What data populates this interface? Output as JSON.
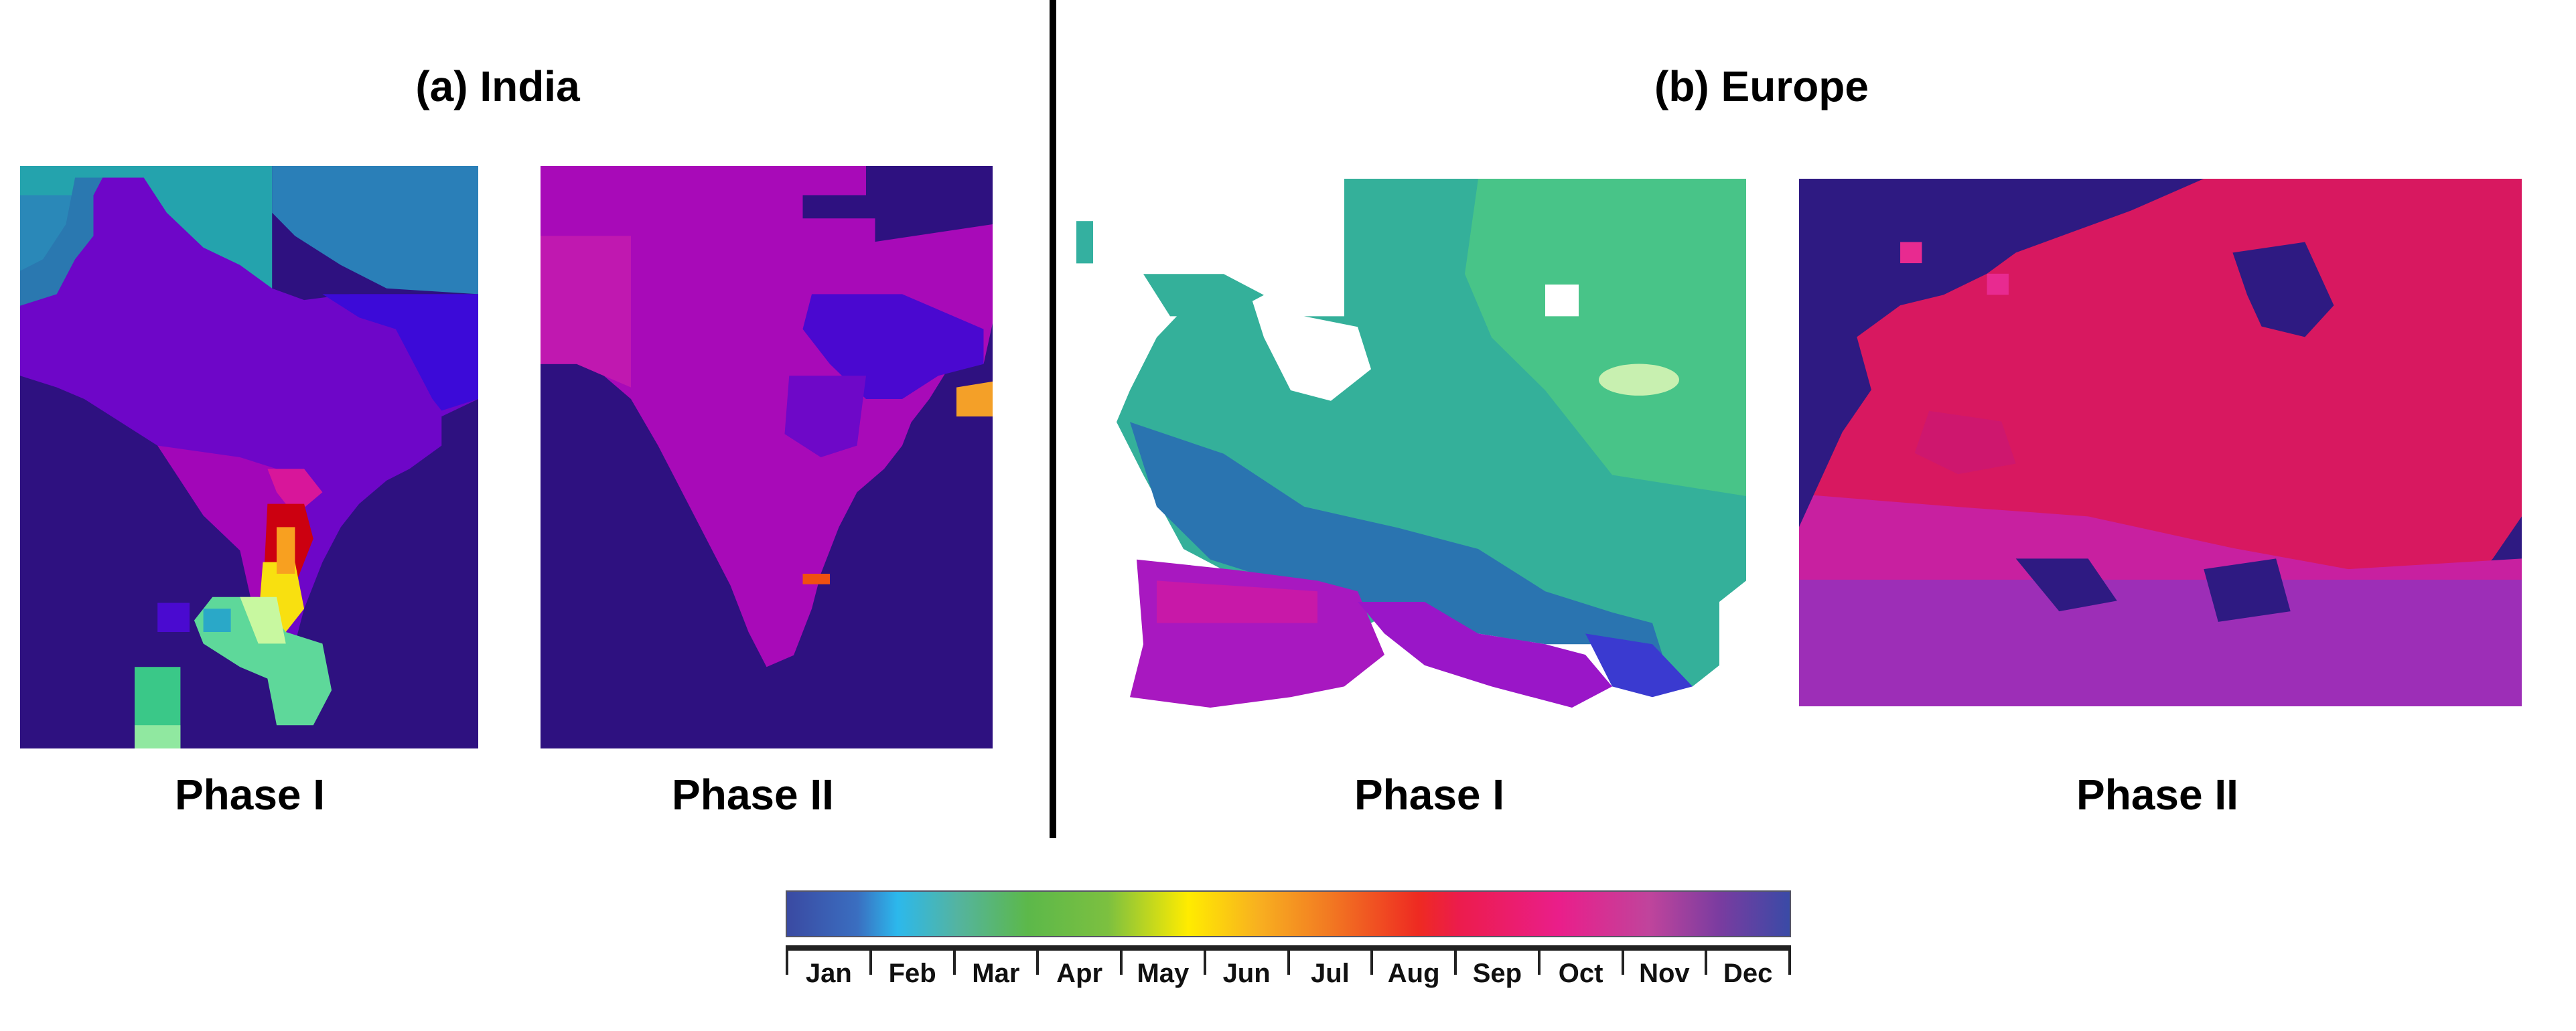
{
  "panels": {
    "india": {
      "title": "(a) India",
      "phase1_label": "Phase I",
      "phase2_label": "Phase II"
    },
    "europe": {
      "title": "(b) Europe",
      "phase1_label": "Phase I",
      "phase2_label": "Phase II"
    }
  },
  "colorbar": {
    "months": [
      "Jan",
      "Feb",
      "Mar",
      "Apr",
      "May",
      "Jun",
      "Jul",
      "Aug",
      "Sep",
      "Oct",
      "Nov",
      "Dec"
    ],
    "colors": [
      "#3a4aa2",
      "#2cb8ec",
      "#5cb84a",
      "#7cc040",
      "#ffec00",
      "#f8b020",
      "#f27a22",
      "#ee2a22",
      "#ec1c4c",
      "#ea1e8a",
      "#c0449c",
      "#3a4aa6"
    ]
  },
  "colors": {
    "ocean_india": "#2e1180",
    "ocean_europe_phase2": "#2e1a82"
  }
}
